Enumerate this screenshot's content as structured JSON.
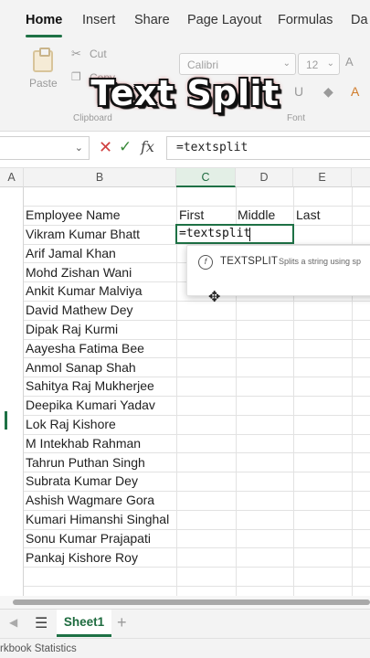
{
  "ribbon": {
    "tabs": [
      "Home",
      "Insert",
      "Share",
      "Page Layout",
      "Formulas",
      "Da"
    ],
    "active_tab": "Home",
    "cut_label": "Cut",
    "copy_label": "Copy",
    "paste_label": "Paste",
    "clipboard_group": "Clipboard",
    "font_name": "Calibri",
    "font_size": "12",
    "font_group": "Font"
  },
  "overlay_title": "Text Split",
  "formula_bar": {
    "formula": "=textsplit"
  },
  "columns": [
    "A",
    "B",
    "C",
    "D",
    "E"
  ],
  "active_column": "C",
  "headers": {
    "name": "Employee Name",
    "first": "First",
    "middle": "Middle",
    "last": "Last"
  },
  "employees": [
    "Vikram Kumar Bhatt",
    "Arif Jamal Khan",
    "Mohd Zishan Wani",
    "Ankit Kumar Malviya",
    "David Mathew Dey",
    "Dipak Raj Kurmi",
    "Aayesha Fatima Bee",
    "Anmol Sanap Shah",
    "Sahitya Raj Mukherjee",
    "Deepika Kumari Yadav",
    "Lok Raj Kishore",
    "M Intekhab Rahman",
    "Tahrun Puthan Singh",
    "Subrata Kumar Dey",
    "Ashish Wagmare Gora",
    "Kumari Himanshi Singhal",
    "Sonu Kumar Prajapati",
    "Pankaj Kishore Roy"
  ],
  "active_cell_value": "=textsplit",
  "autocomplete": {
    "function_name": "TEXTSPLIT",
    "description": "Splits a string using sp"
  },
  "sheet_tabs": [
    "Sheet1"
  ],
  "status_text": "rkbook Statistics",
  "colors": {
    "accent": "#1e7145",
    "cancel": "#d04040",
    "confirm": "#3a8a3a"
  }
}
